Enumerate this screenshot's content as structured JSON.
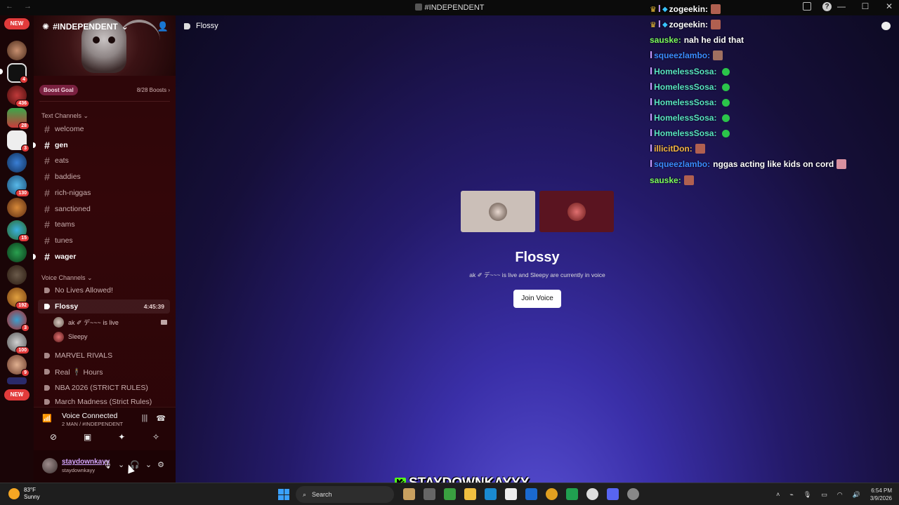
{
  "titlebar": {
    "title": "#INDEPENDENT",
    "nav": "←  →",
    "minimize": "—",
    "maximize": "☐",
    "close": "✕"
  },
  "rail": {
    "new_top": "NEW",
    "new_bottom": "NEW",
    "badges": [
      "4",
      "436",
      "28",
      "3",
      "130",
      "15",
      "192",
      "3",
      "100",
      "9"
    ]
  },
  "server": {
    "name": "#INDEPENDENT",
    "boost_goal": "Boost Goal",
    "boost_count": "8/28 Boosts ›"
  },
  "text_channels": {
    "category": "Text Channels",
    "items": [
      "welcome",
      "gen",
      "eats",
      "baddies",
      "rich-niggas",
      "sanctioned",
      "teams",
      "tunes",
      "wager"
    ]
  },
  "voice_channels": {
    "category": "Voice Channels",
    "items": [
      "No Lives Allowed!",
      "Flossy",
      "MARVEL RIVALS",
      "Real 🕴 Hours",
      "NBA 2026 (STRICT RULES)",
      "March Madness (Strict Rules)"
    ],
    "active_timer": "4:45:39",
    "users": [
      "ak ✐ デ~~~ is live",
      "Sleepy"
    ]
  },
  "voice_panel": {
    "status": "Voice Connected",
    "sub": "2 MAN / #INDEPENDENT"
  },
  "user_panel": {
    "username": "staydownkayy",
    "tag": "staydownkayy"
  },
  "main": {
    "channel": "Flossy",
    "title": "Flossy",
    "subtitle": "ak ✐ デ~~~ is live and Sleepy are currently in voice",
    "join_button": "Join Voice"
  },
  "chat": {
    "messages": [
      {
        "user": "zogeekin:",
        "text": "",
        "color": "#ffffff"
      },
      {
        "user": "zogeekin:",
        "text": "",
        "color": "#ffffff"
      },
      {
        "user": "sauske:",
        "text": "nah he did that",
        "color": "#7cfc5c"
      },
      {
        "user": "squeezlambo:",
        "text": "",
        "color": "#3a8bff"
      },
      {
        "user": "HomelessSosa:",
        "text": "",
        "color": "#58e3c0"
      },
      {
        "user": "HomelessSosa:",
        "text": "",
        "color": "#58e3c0"
      },
      {
        "user": "HomelessSosa:",
        "text": "",
        "color": "#58e3c0"
      },
      {
        "user": "HomelessSosa:",
        "text": "",
        "color": "#58e3c0"
      },
      {
        "user": "HomelessSosa:",
        "text": "",
        "color": "#58e3c0"
      },
      {
        "user": "illicitDon:",
        "text": "",
        "color": "#f2b441"
      },
      {
        "user": "squeezlambo:",
        "text": "nggas acting like kids on cord",
        "color": "#3a8bff"
      },
      {
        "user": "sauske:",
        "text": "",
        "color": "#7cfc5c"
      }
    ]
  },
  "watermark": "STAYDOWNKAYYY",
  "taskbar": {
    "temp": "83°F",
    "weather": "Sunny",
    "search": "Search",
    "time": "6:54 PM",
    "date": "3/9/2026"
  },
  "colors": {
    "accent": "#5865f2",
    "sidebar_bg": "#2b0609",
    "rail_bg": "#1a0507"
  }
}
